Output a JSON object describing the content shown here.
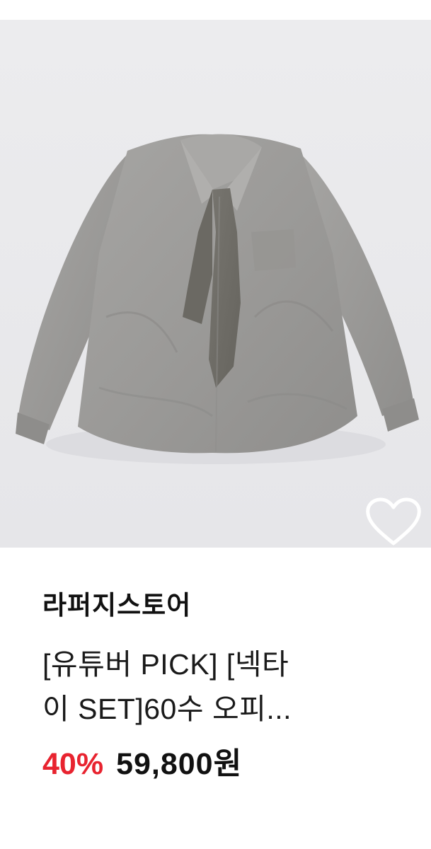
{
  "product": {
    "image_alt": "gray oversized shirt with matching tie",
    "wishlist_icon": "heart-outline-icon",
    "brand": "라퍼지스토어",
    "title_line1": "[유튜버 PICK] [넥타",
    "title_line2": "이 SET]60수 오피...",
    "discount": "40%",
    "price": "59,800원"
  },
  "colors": {
    "photo_background": "#e9e9ec",
    "shirt": "#9c9b99",
    "tie": "#6f6d67",
    "discount": "#e8232f",
    "text": "#111111"
  }
}
